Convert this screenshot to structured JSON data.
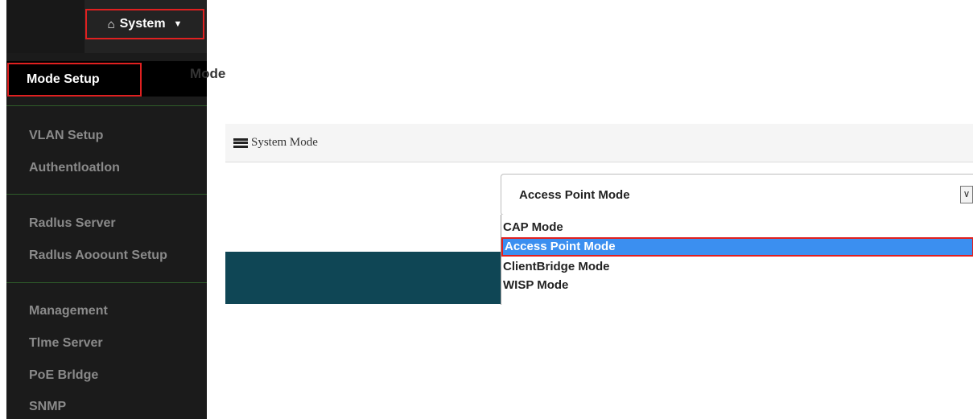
{
  "header": {
    "system_menu_label": "System",
    "home_icon": "home-icon",
    "caret_icon": "caret-down-icon"
  },
  "sidebar": {
    "active_item": "Mode Setup",
    "groups": [
      [
        "VLAN Setup",
        "Authentloatlon"
      ],
      [
        "Radlus Server",
        "Radlus Aooount Setup"
      ],
      [
        "Management",
        "Tlme Server",
        "PoE Brldge",
        "SNMP"
      ]
    ]
  },
  "panel": {
    "title": "System Mode",
    "title_icon": "list-icon",
    "mode_label": "Mode",
    "mode_value": "Access Point Mode",
    "options": [
      "CAP Mode",
      "Access Point Mode",
      "ClientBridge Mode",
      "WISP Mode"
    ],
    "selected_option": "Access Point Mode"
  },
  "colors": {
    "highlight_border": "#e02020",
    "selected_option_bg": "#3b8ff0",
    "sidebar_bg": "#1b1b1b",
    "footer_bg": "#0f4655"
  }
}
